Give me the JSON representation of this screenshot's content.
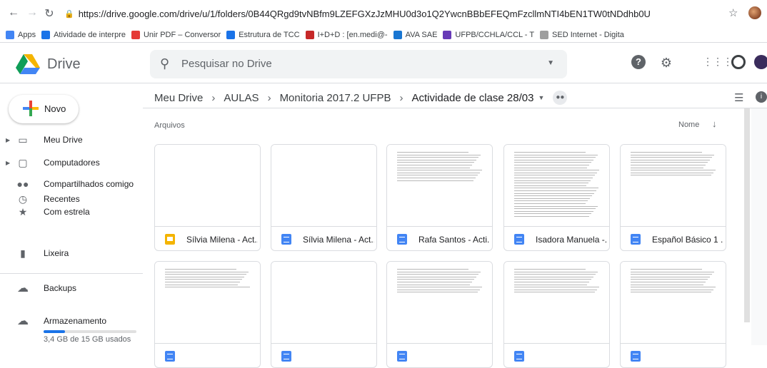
{
  "browser": {
    "url": "https://drive.google.com/drive/u/1/folders/0B44QRgd9tvNBfm9LZEFGXzJzMHU0d3o1Q2YwcnBBbEFEQmFzcllmNTI4bEN1TW0tNDdhb0U",
    "bookmarks": [
      {
        "label": "Apps",
        "color": "#4285f4"
      },
      {
        "label": "Atividade de interpre",
        "color": "#1a73e8"
      },
      {
        "label": "Unir PDF – Conversor",
        "color": "#e53935"
      },
      {
        "label": "Estrutura de TCC",
        "color": "#1a73e8"
      },
      {
        "label": "I+D+D : [en.medi@-",
        "color": "#c62828"
      },
      {
        "label": "AVA SAE",
        "color": "#1976d2"
      },
      {
        "label": "UFPB/CCHLA/CCL - T",
        "color": "#673ab7"
      },
      {
        "label": "SED Internet - Digita",
        "color": "#9e9e9e"
      }
    ]
  },
  "header": {
    "brand": "Drive",
    "search_placeholder": "Pesquisar no Drive",
    "colors": {
      "drive_green": "#0f9d58",
      "drive_yellow": "#f4b400",
      "drive_blue": "#4285f4"
    }
  },
  "sidebar": {
    "new_label": "Novo",
    "items": [
      {
        "label": "Meu Drive",
        "icon": "drive-icon"
      },
      {
        "label": "Computadores",
        "icon": "computer-icon"
      },
      {
        "label": "Compartilhados comigo",
        "icon": "people-icon"
      },
      {
        "label": "Recentes",
        "icon": "clock-icon"
      },
      {
        "label": "Com estrela",
        "icon": "star-icon"
      },
      {
        "label": "Lixeira",
        "icon": "trash-icon"
      },
      {
        "label": "Backups",
        "icon": "cloud-icon"
      },
      {
        "label": "Armazenamento",
        "icon": "cloud-outline-icon"
      }
    ],
    "storage": {
      "text": "3,4 GB de 15 GB usados",
      "used_fraction": 0.227
    }
  },
  "main": {
    "breadcrumb": [
      "Meu Drive",
      "AULAS",
      "Monitoria 2017.2 UFPB",
      "Actividade de clase 28/03"
    ],
    "section_label": "Arquivos",
    "sort_label": "Nome",
    "files": [
      {
        "name": "Sílvia Milena - Act...",
        "type": "slide"
      },
      {
        "name": "Sílvia Milena - Act...",
        "type": "doc"
      },
      {
        "name": "Rafa Santos - Acti...",
        "type": "doc"
      },
      {
        "name": "Isadora Manuela -...",
        "type": "doc"
      },
      {
        "name": "Español Básico 1 ...",
        "type": "doc"
      },
      {
        "name": "",
        "type": "doc"
      },
      {
        "name": "",
        "type": "doc"
      },
      {
        "name": "",
        "type": "doc"
      },
      {
        "name": "",
        "type": "doc"
      },
      {
        "name": "",
        "type": "doc"
      }
    ]
  }
}
